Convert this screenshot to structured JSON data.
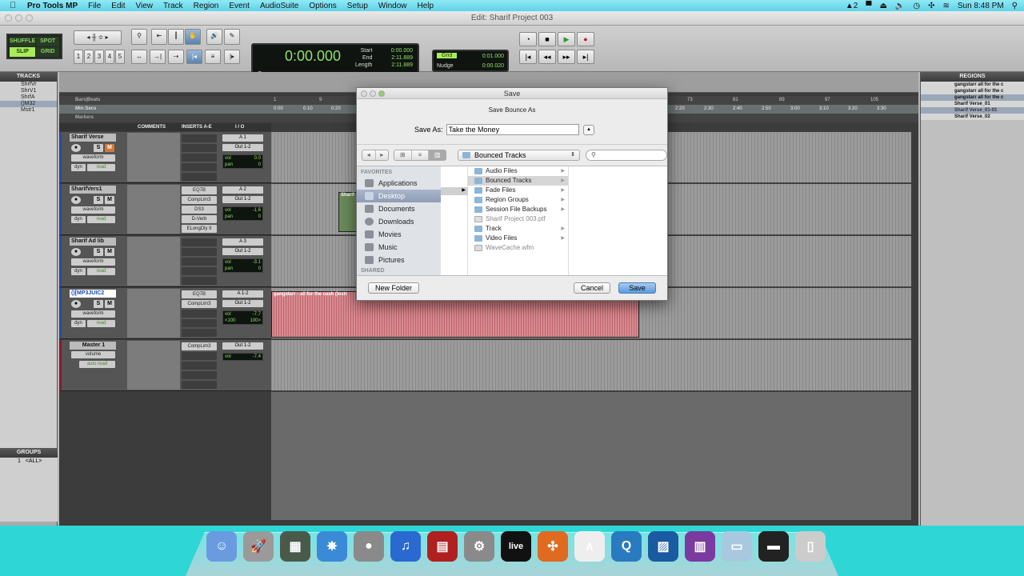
{
  "menubar": {
    "app": "Pro Tools MP",
    "items": [
      "File",
      "Edit",
      "View",
      "Track",
      "Region",
      "Event",
      "AudioSuite",
      "Options",
      "Setup",
      "Window",
      "Help"
    ],
    "status": {
      "adobe": "2",
      "clock": "Sun 8:48 PM"
    }
  },
  "window": {
    "title": "Edit: Sharif Project 003"
  },
  "toolbar": {
    "modes": {
      "shuffle": "SHUFFLE",
      "spot": "SPOT",
      "slip": "SLIP",
      "grid": "GRID",
      "active": "SLIP"
    },
    "zoom_presets": [
      "1",
      "2",
      "3",
      "4",
      "5"
    ],
    "counter": {
      "main": "0:00.000",
      "start_label": "Start",
      "end_label": "End",
      "length_label": "Length",
      "start": "0:00.000",
      "end": "2:11.889",
      "length": "2:11.889",
      "cursor_label": "Cursor"
    },
    "grid": {
      "label": "Grid",
      "value": "0:01.000",
      "nudge_label": "Nudge",
      "nudge_value": "0:00.020"
    }
  },
  "tracks_panel": {
    "title": "TRACKS",
    "items": [
      {
        "name": "ShrfVr",
        "selected": false
      },
      {
        "name": "ShrV1",
        "selected": false
      },
      {
        "name": "ShrfA",
        "selected": false
      },
      {
        "name": "()M32",
        "selected": true
      },
      {
        "name": "Mstr1",
        "selected": false
      }
    ]
  },
  "groups_panel": {
    "title": "GROUPS",
    "items": [
      {
        "id": "1",
        "name": "<ALL>"
      }
    ]
  },
  "rulers": {
    "bars_beats": "Bars|Beats",
    "min_secs": "Min:Secs",
    "markers": "Markers",
    "bar_ticks": [
      "1",
      "9",
      "73",
      "81",
      "89",
      "97",
      "105"
    ],
    "time_ticks": [
      "0:00",
      "0:10",
      "0:20",
      "2:20",
      "2:30",
      "2:40",
      "2:50",
      "3:00",
      "3:10",
      "3:20",
      "3:30"
    ]
  },
  "columns": {
    "comments": "COMMENTS",
    "inserts": "INSERTS A-E",
    "io": "I / O"
  },
  "tracks": [
    {
      "name": "Sharif Verse",
      "view": "waveform",
      "dyn": "dyn",
      "auto": "read",
      "inserts": [],
      "input": "A 1",
      "output": "Out 1-2",
      "vol": "0.0",
      "pan": "0",
      "mute_on": true
    },
    {
      "name": "SharifVers1",
      "view": "waveform",
      "dyn": "dyn",
      "auto": "read",
      "inserts": [
        "EQ7B",
        "CompLim3",
        "DS3",
        "D-Verb",
        "ELongDly II"
      ],
      "input": "A 2",
      "output": "Out 1-2",
      "vol": "-1.6",
      "pan": "0",
      "mute_on": false
    },
    {
      "name": "Sharif Ad lib",
      "view": "waveform",
      "dyn": "dyn",
      "auto": "read",
      "inserts": [],
      "input": "A 3",
      "output": "Out 1-2",
      "vol": "-3.1",
      "pan": "0",
      "mute_on": false
    },
    {
      "name": "()[MP3JUIC2",
      "view": "waveform",
      "dyn": "dyn",
      "auto": "read",
      "inserts": [
        "EQ7B",
        "CompLim3"
      ],
      "input": "A 1-2",
      "output": "Out 1-2",
      "vol": "-7.7",
      "pan_l": "<100",
      "pan_r": "100>",
      "mute_on": false
    },
    {
      "name": "Master 1",
      "view": "volume",
      "auto": "auto read",
      "inserts": [
        "CompLim3"
      ],
      "output": "Out 1-2",
      "vol": "-7.4"
    }
  ],
  "clips": {
    "small": "Sharif",
    "main": "gangstarr - all for the cash (instr"
  },
  "regions_panel": {
    "title": "REGIONS",
    "items": [
      {
        "name": "gangstarr   all for the c",
        "selected": false
      },
      {
        "name": "gangstarr   all for the c",
        "selected": false
      },
      {
        "name": "gangstarr   all for the c",
        "selected": true
      },
      {
        "name": "Sharif Verse_01",
        "selected": false
      },
      {
        "name": "Sharif Verse_01-01",
        "selected": true
      },
      {
        "name": "Sharif Verse_02",
        "selected": false
      }
    ]
  },
  "save_dialog": {
    "title": "Save",
    "subtitle": "Save Bounce As",
    "save_as_label": "Save As:",
    "filename": "Take the Money",
    "location": "Bounced Tracks",
    "search_placeholder": "",
    "favorites_header": "FAVORITES",
    "shared_header": "SHARED",
    "favorites": [
      {
        "name": "Applications",
        "icon": "applications-icon",
        "selected": false
      },
      {
        "name": "Desktop",
        "icon": "desktop-icon",
        "selected": true
      },
      {
        "name": "Documents",
        "icon": "documents-icon",
        "selected": false
      },
      {
        "name": "Downloads",
        "icon": "downloads-icon",
        "selected": false
      },
      {
        "name": "Movies",
        "icon": "movies-icon",
        "selected": false
      },
      {
        "name": "Music",
        "icon": "music-icon",
        "selected": false
      },
      {
        "name": "Pictures",
        "icon": "pictures-icon",
        "selected": false
      }
    ],
    "files": [
      {
        "name": "Audio Files",
        "type": "folder",
        "selected": false
      },
      {
        "name": "Bounced Tracks",
        "type": "folder",
        "selected": true
      },
      {
        "name": "Fade Files",
        "type": "folder",
        "selected": false
      },
      {
        "name": "Region Groups",
        "type": "folder",
        "selected": false
      },
      {
        "name": "Session File Backups",
        "type": "folder",
        "selected": false
      },
      {
        "name": "Sharif Project 003.ptf",
        "type": "file",
        "selected": false
      },
      {
        "name": "Track",
        "type": "folder",
        "selected": false
      },
      {
        "name": "Video Files",
        "type": "folder",
        "selected": false
      },
      {
        "name": "WaveCache.wfm",
        "type": "file",
        "selected": false
      }
    ],
    "new_folder": "New Folder",
    "cancel": "Cancel",
    "save": "Save"
  },
  "dock": {
    "apps": [
      {
        "name": "Finder",
        "color": "#6a9be0",
        "glyph": "☺"
      },
      {
        "name": "Launchpad",
        "color": "#9a9a9a",
        "glyph": "🚀"
      },
      {
        "name": "Image Capture",
        "color": "#4a5a4a",
        "glyph": "▦"
      },
      {
        "name": "Safari",
        "color": "#3a8ad8",
        "glyph": "✵"
      },
      {
        "name": "FaceTime",
        "color": "#8a8a8a",
        "glyph": "●"
      },
      {
        "name": "iTunes",
        "color": "#2a6ad0",
        "glyph": "♫"
      },
      {
        "name": "Photo Booth",
        "color": "#b02020",
        "glyph": "▤"
      },
      {
        "name": "System Preferences",
        "color": "#8a8a8a",
        "glyph": "⚙"
      },
      {
        "name": "Ableton Live",
        "color": "#111111",
        "glyph": "live"
      },
      {
        "name": "Reason",
        "color": "#e06a20",
        "glyph": "✣"
      },
      {
        "name": "Pro Tools",
        "color": "#eeeeee",
        "glyph": "∧"
      },
      {
        "name": "QuickTime",
        "color": "#2a7ac0",
        "glyph": "Q"
      },
      {
        "name": "Photo Editor",
        "color": "#1a5aa0",
        "glyph": "▨"
      },
      {
        "name": "Video Editor",
        "color": "#7a3aa0",
        "glyph": "▥"
      },
      {
        "name": "Documents Folder",
        "color": "#a8c8e0",
        "glyph": "▭"
      },
      {
        "name": "Device",
        "color": "#222222",
        "glyph": "▬"
      },
      {
        "name": "Trash",
        "color": "#cccccc",
        "glyph": "▯"
      }
    ]
  }
}
